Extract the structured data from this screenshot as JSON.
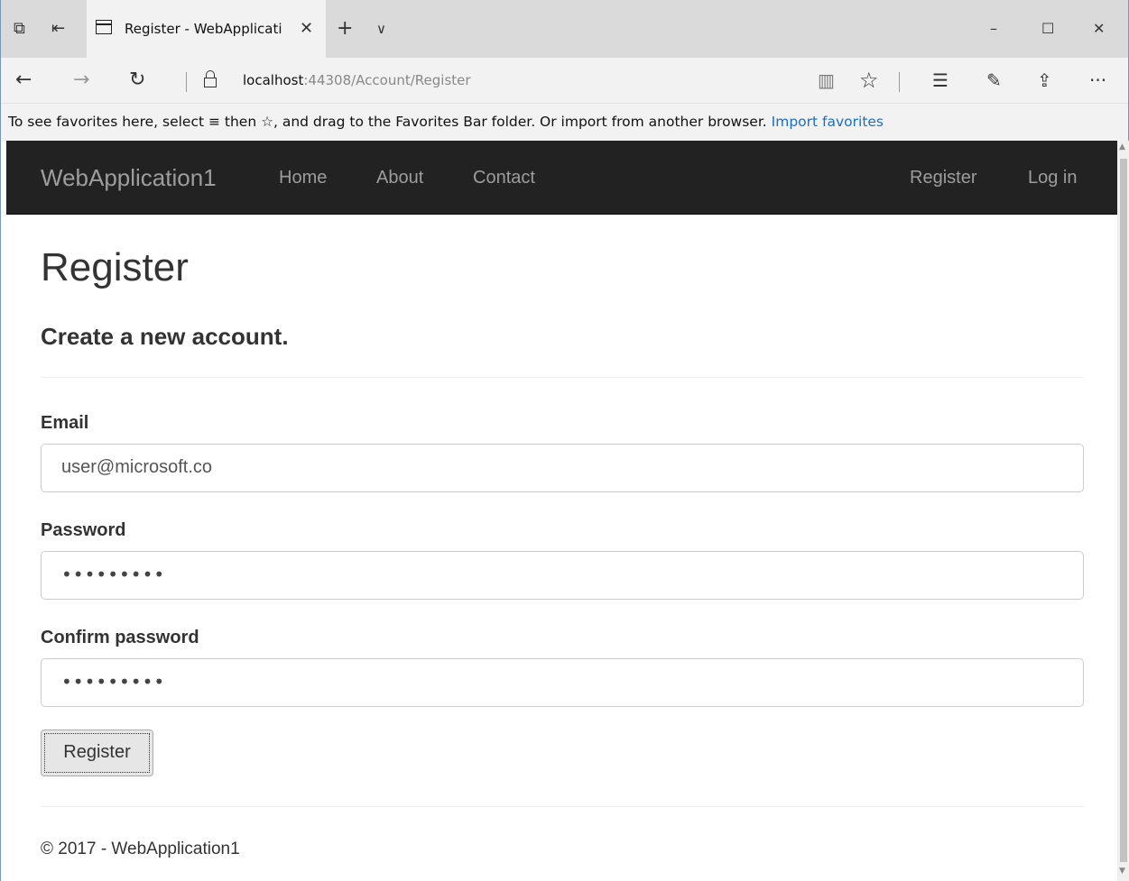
{
  "browser": {
    "tab_title": "Register - WebApplicati",
    "close_glyph": "✕",
    "new_tab_glyph": "+",
    "tab_menu_glyph": "∨",
    "minimize_glyph": "–",
    "maximize_glyph": "☐",
    "window_close_glyph": "✕",
    "back_glyph": "←",
    "forward_glyph": "→",
    "refresh_glyph": "↻",
    "url_host": "localhost",
    "url_rest": ":44308/Account/Register",
    "reading_view_glyph": "▥",
    "favorite_glyph": "☆",
    "hub_glyph": "☰",
    "notes_glyph": "✎",
    "share_glyph": "⇪",
    "more_glyph": "···",
    "favorites_message": "To see favorites here, select ≡ then ☆, and drag to the Favorites Bar folder. Or import from another browser.",
    "import_favorites": "Import favorites",
    "icons": [
      "tab-manager-icon",
      "set-aside-tabs-icon",
      "page-icon",
      "lock-icon",
      "reading-view-icon",
      "favorite-star-icon",
      "hub-icon",
      "web-note-icon",
      "share-icon",
      "more-icon"
    ]
  },
  "navbar": {
    "brand": "WebApplication1",
    "links": [
      "Home",
      "About",
      "Contact"
    ],
    "register": "Register",
    "login": "Log in",
    "background": "#222222",
    "link_color": "#9d9d9d"
  },
  "page": {
    "title": "Register",
    "subtitle": "Create a new account.",
    "email_label": "Email",
    "email_value": "user@microsoft.co",
    "password_label": "Password",
    "password_value": "•••••••••",
    "confirm_label": "Confirm password",
    "confirm_value": "•••••••••",
    "submit_label": "Register",
    "footer": "© 2017 - WebApplication1"
  }
}
